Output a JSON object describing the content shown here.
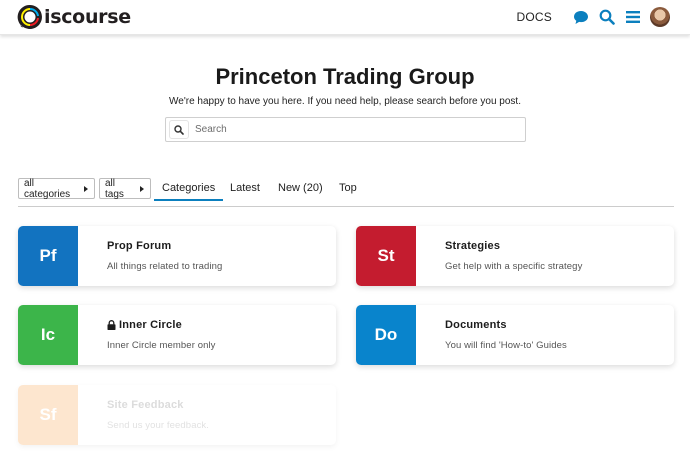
{
  "header": {
    "logo_text": "iscourse",
    "docs_label": "DOCS",
    "icons": [
      "chat-icon",
      "search-icon",
      "menu-icon",
      "avatar"
    ]
  },
  "banner": {
    "title": "Princeton Trading Group",
    "subtitle": "We're happy to have you here. If you need help, please search before you post.",
    "search_placeholder": "Search"
  },
  "nav": {
    "categories_dropdown": "all categories",
    "tags_dropdown": "all tags",
    "tabs": [
      {
        "label": "Categories",
        "active": true
      },
      {
        "label": "Latest",
        "active": false
      },
      {
        "label": "New (20)",
        "active": false
      },
      {
        "label": "Top",
        "active": false
      }
    ]
  },
  "categories": [
    {
      "badge": "Pf",
      "name": "Prop Forum",
      "description": "All things related to trading",
      "color": "#1273c0",
      "locked": false
    },
    {
      "badge": "St",
      "name": "Strategies",
      "description": "Get help with a specific strategy",
      "color": "#c41c2f",
      "locked": false
    },
    {
      "badge": "Ic",
      "name": "Inner Circle",
      "description": "Inner Circle member only",
      "color": "#3cb54a",
      "locked": true
    },
    {
      "badge": "Do",
      "name": "Documents",
      "description": "You will find 'How-to' Guides",
      "color": "#0984cc",
      "locked": false
    },
    {
      "badge": "Sf",
      "name": "Site Feedback",
      "description": "Send us your feedback.",
      "color": "#fde6cf",
      "locked": false
    }
  ],
  "colors": {
    "accent": "#0b7fbe"
  }
}
